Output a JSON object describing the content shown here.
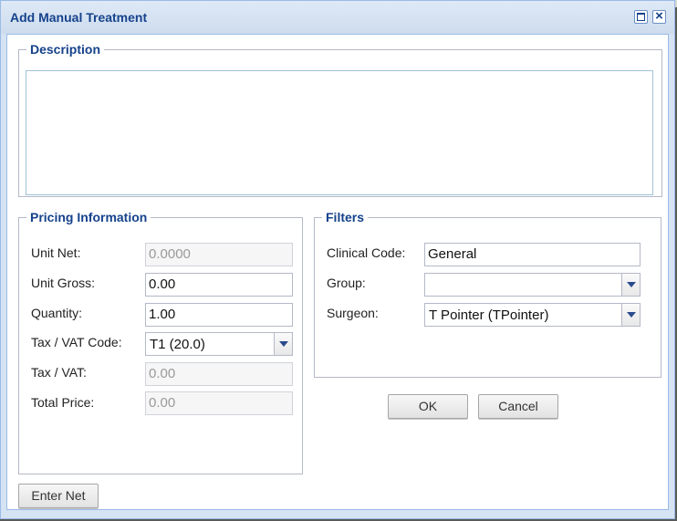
{
  "dialog": {
    "title": "Add Manual Treatment"
  },
  "description": {
    "legend": "Description",
    "value": ""
  },
  "pricing": {
    "legend": "Pricing Information",
    "fields": [
      {
        "label": "Unit Net:",
        "value": "0.0000",
        "disabled": true
      },
      {
        "label": "Unit Gross:",
        "value": "0.00",
        "disabled": false
      },
      {
        "label": "Quantity:",
        "value": "1.00",
        "disabled": false
      },
      {
        "label": "Tax / VAT Code:",
        "value": "T1 (20.0)",
        "type": "combo"
      },
      {
        "label": "Tax / VAT:",
        "value": "0.00",
        "disabled": true
      },
      {
        "label": "Total Price:",
        "value": "0.00",
        "disabled": true
      }
    ]
  },
  "filters": {
    "legend": "Filters",
    "clinical_code": {
      "label": "Clinical Code:",
      "value": "General"
    },
    "group": {
      "label": "Group:",
      "value": ""
    },
    "surgeon": {
      "label": "Surgeon:",
      "value": "T Pointer (TPointer)"
    }
  },
  "buttons": {
    "ok": "OK",
    "cancel": "Cancel",
    "enter_net": "Enter Net"
  },
  "colors": {
    "title": "#15428b",
    "frame": "#99bbe8",
    "header_bg": "#dfe9f6"
  }
}
